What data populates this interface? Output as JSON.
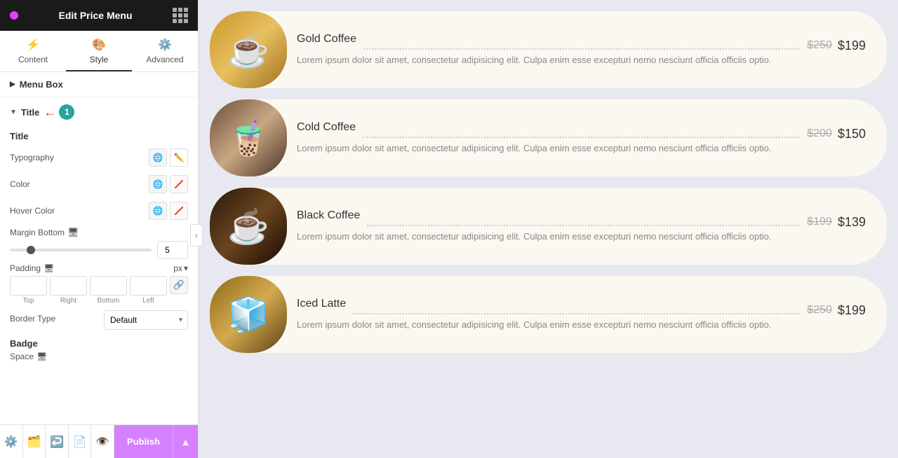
{
  "header": {
    "title": "Edit Price Menu",
    "dot_color": "#e040fb"
  },
  "tabs": [
    {
      "id": "content",
      "label": "Content",
      "icon": "⚡"
    },
    {
      "id": "style",
      "label": "Style",
      "icon": "🎨",
      "active": true
    },
    {
      "id": "advanced",
      "label": "Advanced",
      "icon": "⚙️"
    }
  ],
  "sections": {
    "menu_box": {
      "label": "Menu Box"
    },
    "title": {
      "label": "Title",
      "badge": "1",
      "subsection": "Title"
    }
  },
  "controls": {
    "typography": {
      "label": "Typography"
    },
    "color": {
      "label": "Color"
    },
    "hover_color": {
      "label": "Hover Color"
    },
    "margin_bottom": {
      "label": "Margin Bottom",
      "value": "5"
    },
    "padding": {
      "label": "Padding",
      "unit": "px",
      "top": "",
      "right": "",
      "bottom": "",
      "left": ""
    },
    "border_type": {
      "label": "Border Type",
      "value": "Default"
    },
    "badge": {
      "label": "Badge"
    },
    "space": {
      "label": "Space"
    }
  },
  "toolbar": {
    "publish_label": "Publish",
    "icons": [
      "⚙️",
      "🗂️",
      "↩️",
      "📄",
      "👁️"
    ]
  },
  "menu_items": [
    {
      "id": "gold-coffee",
      "title": "Gold Coffee",
      "description": "Lorem ipsum dolor sit amet, consectetur adipisicing elit. Culpa enim esse excepturi nemo nesciunt officia officiis optio.",
      "price_old": "$250",
      "price_new": "$199",
      "img_class": "img-gold",
      "emoji": "☕"
    },
    {
      "id": "cold-coffee",
      "title": "Cold Coffee",
      "description": "Lorem ipsum dolor sit amet, consectetur adipisicing elit. Culpa enim esse excepturi nemo nesciunt officia officiis optio.",
      "price_old": "$200",
      "price_new": "$150",
      "img_class": "img-cold",
      "emoji": "🧋"
    },
    {
      "id": "black-coffee",
      "title": "Black Coffee",
      "description": "Lorem ipsum dolor sit amet, consectetur adipisicing elit. Culpa enim esse excepturi nemo nesciunt officia officiis optio.",
      "price_old": "$199",
      "price_new": "$139",
      "img_class": "img-black",
      "emoji": "☕"
    },
    {
      "id": "iced-latte",
      "title": "Iced Latte",
      "description": "Lorem ipsum dolor sit amet, consectetur adipisicing elit. Culpa enim esse excepturi nemo nesciunt officia officiis optio.",
      "price_old": "$250",
      "price_new": "$199",
      "img_class": "img-iced",
      "emoji": "🧊"
    }
  ]
}
